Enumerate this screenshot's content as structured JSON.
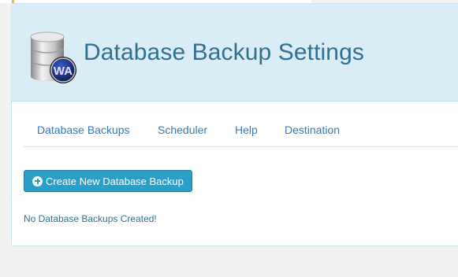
{
  "header": {
    "title": "Database Backup Settings",
    "logo_icon": "database-logo-icon",
    "logo_text": "WA"
  },
  "nav": {
    "items": [
      {
        "label": "Database Backups"
      },
      {
        "label": "Scheduler"
      },
      {
        "label": "Help"
      },
      {
        "label": "Destination"
      }
    ]
  },
  "main": {
    "create_button_label": "Create New Database Backup",
    "create_button_icon": "plus-circle-icon",
    "empty_message": "No Database Backups Created!"
  },
  "colors": {
    "header_bg": "#d9edf7",
    "title": "#31708f",
    "link": "#337ab7",
    "button_bg": "#2a9fc9"
  }
}
